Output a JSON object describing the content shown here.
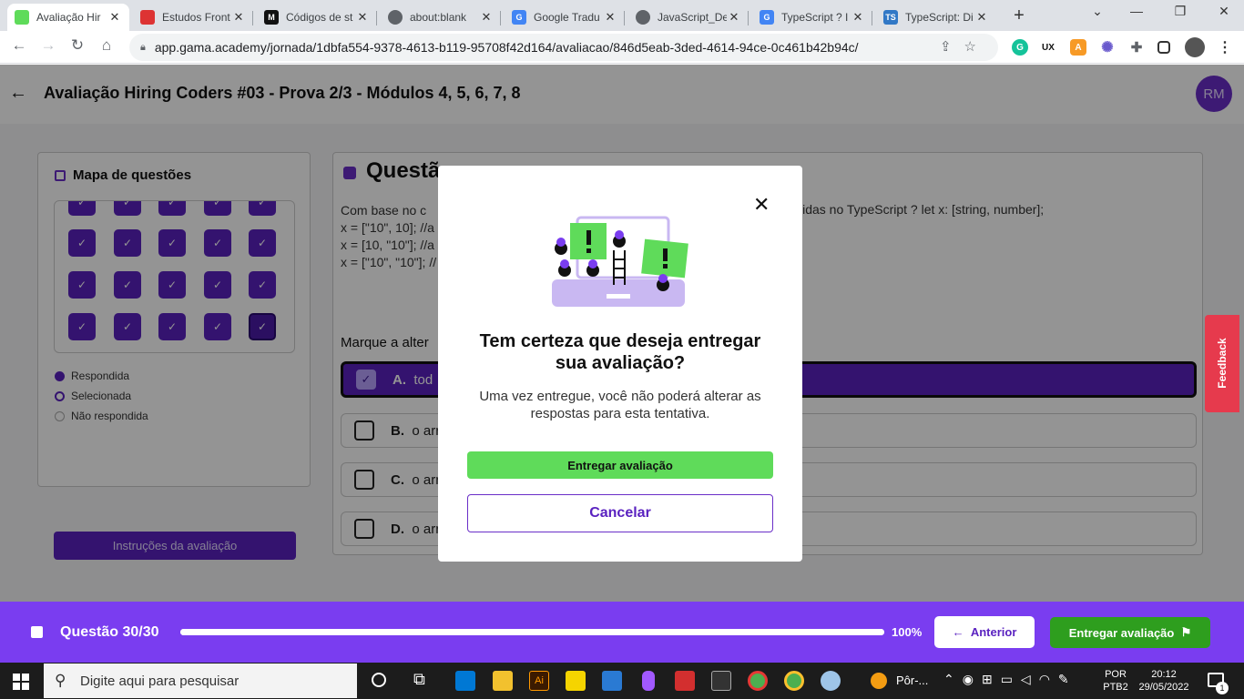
{
  "browser": {
    "tabs": [
      {
        "title": "Avaliação Hir",
        "active": true,
        "favicon_color": "#5fdb5a"
      },
      {
        "title": "Estudos Front",
        "favicon_color": "#d33"
      },
      {
        "title": "Códigos de st",
        "favicon_color": "#111"
      },
      {
        "title": "about:blank",
        "favicon_color": "#5f6368"
      },
      {
        "title": "Google Tradu",
        "favicon_color": "#4285f4"
      },
      {
        "title": "JavaScript_De",
        "favicon_color": "#5f6368"
      },
      {
        "title": "TypeScript ? I",
        "favicon_color": "#4285f4"
      },
      {
        "title": "TypeScript: Di",
        "favicon_color": "#3178c6"
      }
    ],
    "new_tab": "+",
    "url": "app.gama.academy/jornada/1dbfa554-9378-4613-b119-95708f42d164/avaliacao/846d5eab-3ded-4614-94ce-0c461b42b94c/"
  },
  "header": {
    "title": "Avaliação Hiring Coders #03 - Prova 2/3 - Módulos 4, 5, 6, 7, 8",
    "avatar": "RM"
  },
  "map": {
    "title": "Mapa de questões",
    "legend": {
      "answered": "Respondida",
      "selected": "Selecionada",
      "unanswered": "Não respondida"
    },
    "instructions_button": "Instruções da avaliação",
    "check": "✓"
  },
  "question": {
    "heading": "Questã",
    "text_lines": [
      "Com base no c",
      "x = [\"10\", 10]; //a",
      "x = [10, \"10\"]; //a",
      "x = [\"10\", \"10\"]; //"
    ],
    "text_right": "lidas no TypeScript ? let x: [string, number];",
    "instruction": "Marque a alter",
    "options": [
      {
        "letter": "A.",
        "text": "tod",
        "checked": true
      },
      {
        "letter": "B.",
        "text": "o arr"
      },
      {
        "letter": "C.",
        "text": "o arr"
      },
      {
        "letter": "D.",
        "text": "o arr"
      }
    ]
  },
  "feedback": "Feedback",
  "modal": {
    "close": "✕",
    "title": "Tem certeza que deseja entregar sua avaliação?",
    "text": "Uma vez entregue, você não poderá alterar as respostas para esta tentativa.",
    "confirm": "Entregar avaliação",
    "cancel": "Cancelar"
  },
  "footer": {
    "question_counter": "Questão 30/30",
    "progress_percent": 100,
    "progress_label": "100%",
    "prev_button": "Anterior",
    "submit_button": "Entregar avaliação"
  },
  "taskbar": {
    "search_placeholder": "Digite aqui para pesquisar",
    "running_app": "Pôr-...",
    "lang_top": "POR",
    "lang_bottom": "PTB2",
    "time": "20:12",
    "date": "29/05/2022",
    "notifications": "1"
  },
  "colors": {
    "brand_purple": "#5a22c0",
    "accent_green": "#5fdb5a",
    "submit_green": "#2e9e1e"
  }
}
